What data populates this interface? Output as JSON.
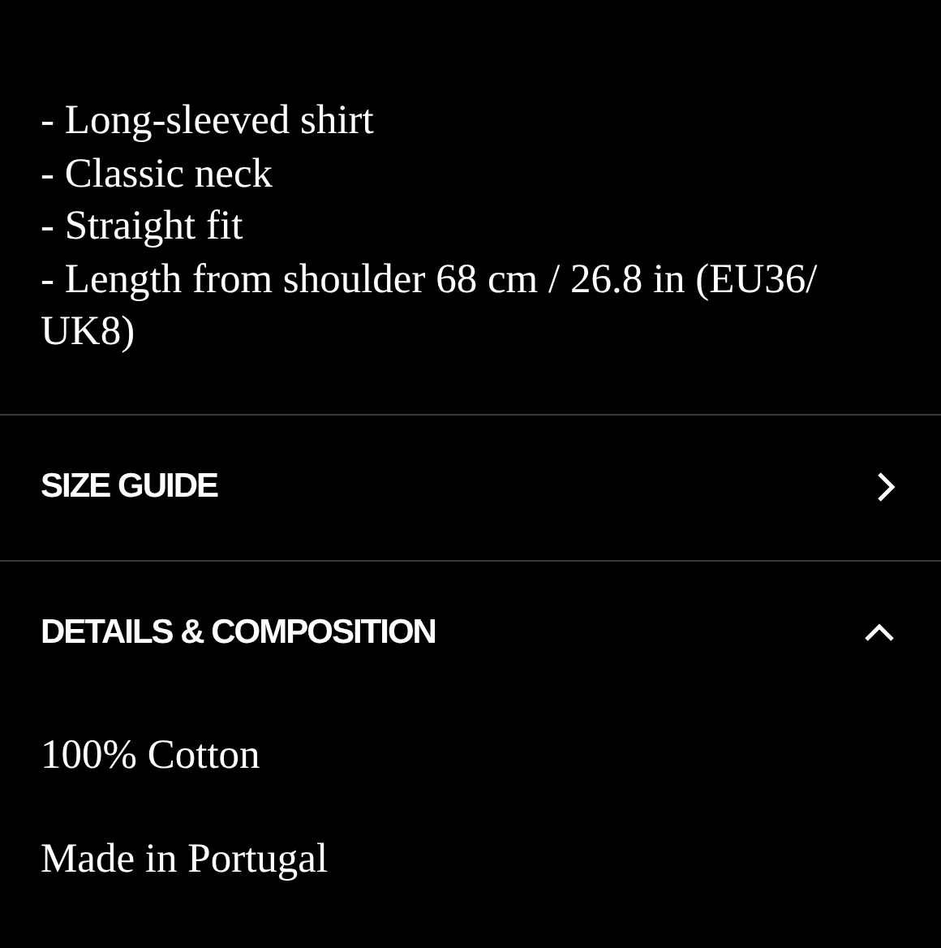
{
  "description_lines": [
    "- Long-sleeved shirt",
    "- Classic neck",
    "- Straight fit",
    "- Length from shoulder 68 cm / 26.8 in (EU36/ UK8)"
  ],
  "sections": [
    {
      "title": "SIZE GUIDE",
      "kind": "link"
    },
    {
      "title": "DETAILS & COMPOSITION",
      "expanded": true,
      "kind": "accordion",
      "content": [
        "100% Cotton",
        "Made in Portugal"
      ]
    }
  ]
}
